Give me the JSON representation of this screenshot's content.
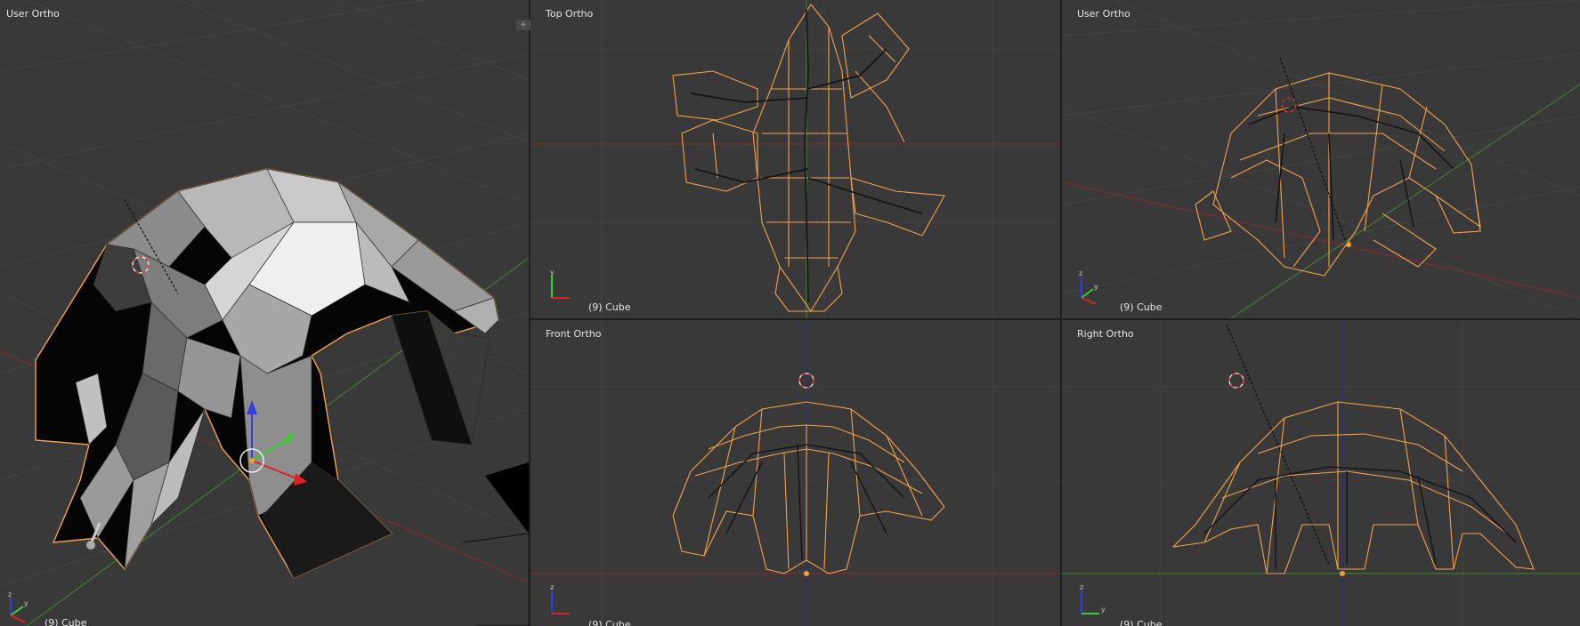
{
  "viewports": {
    "main": {
      "label": "User Ortho",
      "object_label": "(9) Cube"
    },
    "top": {
      "label": "Top Ortho",
      "object_label": "(9) Cube"
    },
    "user2": {
      "label": "User Ortho",
      "object_label": "(9) Cube"
    },
    "front": {
      "label": "Front Ortho",
      "object_label": "(9) Cube"
    },
    "right": {
      "label": "Right Ortho",
      "object_label": "(9) Cube"
    }
  },
  "icons": [
    "axis-gizmo-icon",
    "3d-cursor-icon",
    "transform-manipulator-icon",
    "viewport-split-icon"
  ],
  "colors": {
    "viewport_bg": "#393939",
    "grid": "#444444",
    "x_axis": "#8a2a2a",
    "y_axis": "#3f8a2a",
    "z_axis": "#2a2a8a",
    "selection_wire": "#f5a24a",
    "bone": "#111111"
  }
}
